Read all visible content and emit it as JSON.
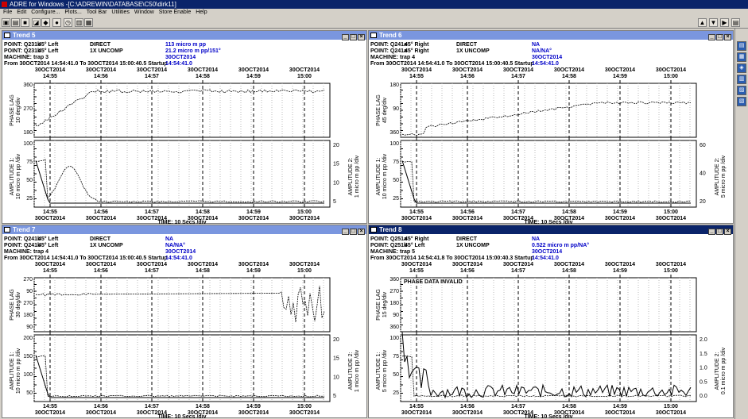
{
  "app": {
    "title": "ADRE for Windows -[C:\\ADREWIN\\DATABASE\\C50\\dirk11]"
  },
  "menu": [
    "File",
    "Edit",
    "Configure...",
    "Plots...",
    "Tool Bar",
    "Utilities",
    "Window",
    "Store Enable",
    "Help"
  ],
  "ticks": {
    "dates": [
      "30OCT2014",
      "30OCT2014",
      "30OCT2014",
      "30OCT2014",
      "30OCT2014",
      "30OCT2014"
    ],
    "times": [
      "14:55",
      "14:56",
      "14:57",
      "14:58",
      "14:59",
      "15:00"
    ],
    "footer": "TIME: 10 Secs /div"
  },
  "trends": [
    {
      "title": "Trend 5",
      "p1": "POINT: Q231b",
      "p1angle": "45° Left",
      "p1type": "DIRECT",
      "p1val": "113 micro m pp",
      "p2": "POINT: Q231b",
      "p2angle": "45° Left",
      "p2type": "1X UNCOMP",
      "p2val": "21.2 micro m pp/151°",
      "machine": "MACHINE: trap 3",
      "date": "30OCT2014",
      "range": "From 30OCT2014 14:54:41.0 To 30OCT2014 15:00:40.5 Startup",
      "start": "14:54:41.0",
      "phase_label": "PHASE LAG",
      "phase_unit": "10 deg/div",
      "phase_ticks": [
        "360",
        "270",
        "180"
      ],
      "amp_label": "AMPLITUDE 1:",
      "amp_unit": "10 micro m pp /div",
      "amp_ticks": [
        "100",
        "75",
        "50",
        "25"
      ],
      "amp2_label": "AMPLITUDE 2:",
      "amp2_unit": "1 micro m pp /div",
      "amp2_ticks": [
        "20",
        "15",
        "10",
        "5"
      ],
      "invalid": ""
    },
    {
      "title": "Trend 6",
      "p1": "POINT: Q241a",
      "p1angle": "45° Right",
      "p1type": "DIRECT",
      "p1val": "NA",
      "p2": "POINT: Q241a",
      "p2angle": "45° Right",
      "p2type": "1X UNCOMP",
      "p2val": "NA/NA°",
      "machine": "MACHINE: trap 4",
      "date": "30OCT2014",
      "range": "From 30OCT2014 14:54:41.0 To 30OCT2014 15:00:40.5 Startup",
      "start": "14:54:41.0",
      "phase_label": "PHASE LAG",
      "phase_unit": "45 deg/div",
      "phase_ticks": [
        "180",
        "90",
        "360"
      ],
      "amp_label": "AMPLITUDE 1:",
      "amp_unit": "10 micro m pp /div",
      "amp_ticks": [
        "100",
        "75",
        "50",
        "25"
      ],
      "amp2_label": "AMPLITUDE 2:",
      "amp2_unit": "5 micro m pp /div",
      "amp2_ticks": [
        "60",
        "40",
        "20"
      ],
      "invalid": ""
    },
    {
      "title": "Trend 7",
      "p1": "POINT: Q241b",
      "p1angle": "45° Left",
      "p1type": "DIRECT",
      "p1val": "NA",
      "p2": "POINT: Q241b",
      "p2angle": "45° Left",
      "p2type": "1X UNCOMP",
      "p2val": "NA/NA°",
      "machine": "MACHINE: trap 4",
      "date": "30OCT2014",
      "range": "From 30OCT2014 14:54:41.0 To 30OCT2014 15:00:40.5 Startup",
      "start": "14:54:41.0",
      "phase_label": "PHASE LAG",
      "phase_unit": "30 deg/div",
      "phase_ticks": [
        "270",
        "90",
        "270",
        "180",
        "90"
      ],
      "amp_label": "AMPLITUDE 1:",
      "amp_unit": "10 micro m pp /div",
      "amp_ticks": [
        "200",
        "150",
        "100",
        "50"
      ],
      "amp2_label": "AMPLITUDE 2:",
      "amp2_unit": "1 micro m pp /div",
      "amp2_ticks": [
        "20",
        "15",
        "10",
        "5"
      ],
      "invalid": ""
    },
    {
      "title": "Trend 8",
      "p1": "POINT: Q251a",
      "p1angle": "45° Right",
      "p1type": "DIRECT",
      "p1val": "NA",
      "p2": "POINT: Q251b",
      "p2angle": "45° Left",
      "p2type": "1X UNCOMP",
      "p2val": "0.522 micro m pp/NA°",
      "machine": "MACHINE: trap 5",
      "date": "30OCT2014",
      "range": "From 30OCT2014 14:54:41.8 To 30OCT2014 15:00:40.3 Startup",
      "start": "14:54:41.0",
      "phase_label": "PHASE LAG",
      "phase_unit": "15 deg/div",
      "phase_ticks": [
        "360",
        "270",
        "180",
        "90",
        "360"
      ],
      "amp_label": "AMPLITUDE 1:",
      "amp_unit": "5 micro m pp /div",
      "amp_ticks": [
        "100",
        "75",
        "50",
        "25"
      ],
      "amp2_label": "AMPLITUDE 2:",
      "amp2_unit": "0.1 micro m pp /div",
      "amp2_ticks": [
        "2.0",
        "1.5",
        "1.0",
        "0.5",
        "0.0"
      ],
      "invalid": "PHASE DATA INVALID"
    }
  ]
}
